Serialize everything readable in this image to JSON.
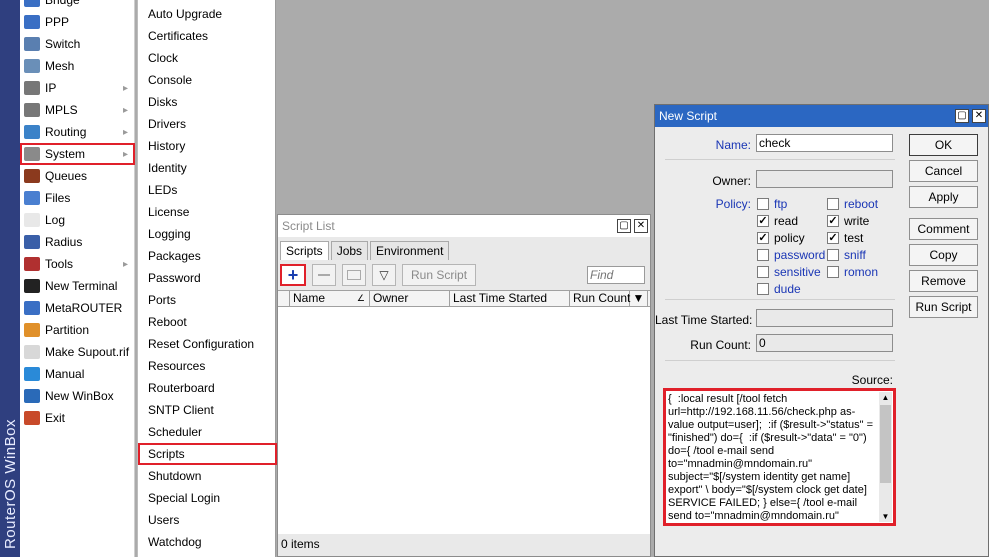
{
  "brand": "RouterOS WinBox",
  "main_menu": [
    {
      "label": "Bridge",
      "icon": "bridge-icon",
      "submenu": false,
      "color": "#3a6fc4"
    },
    {
      "label": "PPP",
      "icon": "ppp-icon",
      "submenu": false,
      "color": "#3a6fc4"
    },
    {
      "label": "Switch",
      "icon": "switch-icon",
      "submenu": false,
      "color": "#5a7fb0"
    },
    {
      "label": "Mesh",
      "icon": "mesh-icon",
      "submenu": false,
      "color": "#6a8fb8"
    },
    {
      "label": "IP",
      "icon": "ip-icon",
      "submenu": true,
      "color": "#777777"
    },
    {
      "label": "MPLS",
      "icon": "mpls-icon",
      "submenu": true,
      "color": "#777777"
    },
    {
      "label": "Routing",
      "icon": "routing-icon",
      "submenu": true,
      "color": "#3b82c8"
    },
    {
      "label": "System",
      "icon": "gear-icon",
      "submenu": true,
      "color": "#8a8a8a"
    },
    {
      "label": "Queues",
      "icon": "queues-icon",
      "submenu": false,
      "color": "#8b3a1e"
    },
    {
      "label": "Files",
      "icon": "files-icon",
      "submenu": false,
      "color": "#4a7fd0"
    },
    {
      "label": "Log",
      "icon": "log-icon",
      "submenu": false,
      "color": "#e8e8e8"
    },
    {
      "label": "Radius",
      "icon": "radius-icon",
      "submenu": false,
      "color": "#3a5fa8"
    },
    {
      "label": "Tools",
      "icon": "tools-icon",
      "submenu": true,
      "color": "#b03030"
    },
    {
      "label": "New Terminal",
      "icon": "terminal-icon",
      "submenu": false,
      "color": "#222222"
    },
    {
      "label": "MetaROUTER",
      "icon": "metarouter-icon",
      "submenu": false,
      "color": "#3a6fc4"
    },
    {
      "label": "Partition",
      "icon": "partition-icon",
      "submenu": false,
      "color": "#e0902a"
    },
    {
      "label": "Make Supout.rif",
      "icon": "supout-icon",
      "submenu": false,
      "color": "#d8d8d8"
    },
    {
      "label": "Manual",
      "icon": "manual-icon",
      "submenu": false,
      "color": "#2a8ad8"
    },
    {
      "label": "New WinBox",
      "icon": "winbox-icon",
      "submenu": false,
      "color": "#2a6ab8"
    },
    {
      "label": "Exit",
      "icon": "exit-icon",
      "submenu": false,
      "color": "#c84a2a"
    }
  ],
  "system_submenu": [
    "Auto Upgrade",
    "Certificates",
    "Clock",
    "Console",
    "Disks",
    "Drivers",
    "History",
    "Identity",
    "LEDs",
    "License",
    "Logging",
    "Packages",
    "Password",
    "Ports",
    "Reboot",
    "Reset Configuration",
    "Resources",
    "Routerboard",
    "SNTP Client",
    "Scheduler",
    "Scripts",
    "Shutdown",
    "Special Login",
    "Users",
    "Watchdog"
  ],
  "script_list": {
    "title": "Script List",
    "tabs": [
      "Scripts",
      "Jobs",
      "Environment"
    ],
    "run_script": "Run Script",
    "find_placeholder": "Find",
    "columns": [
      "Name",
      "Owner",
      "Last Time Started",
      "Run Count"
    ],
    "status": "0 items"
  },
  "new_script": {
    "title": "New Script",
    "name_label": "Name:",
    "name_value": "check",
    "owner_label": "Owner:",
    "owner_value": "",
    "policy_label": "Policy:",
    "policies": [
      {
        "label": "ftp",
        "checked": false
      },
      {
        "label": "reboot",
        "checked": false
      },
      {
        "label": "read",
        "checked": true
      },
      {
        "label": "write",
        "checked": true
      },
      {
        "label": "policy",
        "checked": true
      },
      {
        "label": "test",
        "checked": true
      },
      {
        "label": "password",
        "checked": false
      },
      {
        "label": "sniff",
        "checked": false
      },
      {
        "label": "sensitive",
        "checked": false
      },
      {
        "label": "romon",
        "checked": false
      },
      {
        "label": "dude",
        "checked": false
      }
    ],
    "last_started_label": "Last Time Started:",
    "last_started_value": "",
    "run_count_label": "Run Count:",
    "run_count_value": "0",
    "source_label": "Source:",
    "source": "{  :local result [/tool fetch url=http://192.168.11.56/check.php as-value output=user];  :if ($result->\"status\" = \"finished\") do={  :if ($result->\"data\" = \"0\") do={ /tool e-mail send to=\"mnadmin@mndomain.ru\" subject=\"$[/system identity get name] export\" \\ body=\"$[/system clock get date] SERVICE FAILED; } else={ /tool e-mail send to=\"mnadmin@mndomain.ru\"",
    "buttons": {
      "ok": "OK",
      "cancel": "Cancel",
      "apply": "Apply",
      "comment": "Comment",
      "copy": "Copy",
      "remove": "Remove",
      "run_script": "Run Script"
    }
  },
  "colors": {
    "highlight": "#e0202a",
    "title_active": "#2b67c2",
    "link_blue": "#1a36b5"
  }
}
